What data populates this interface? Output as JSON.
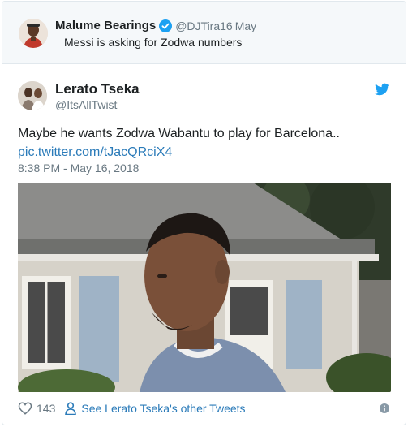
{
  "parent_tweet": {
    "name": "Malume Bearings",
    "handle": "@DJTira16",
    "date": "May",
    "text": "Messi is asking for Zodwa numbers",
    "verified": true
  },
  "tweet": {
    "name": "Lerato Tseka",
    "handle": "@ItsAllTwist",
    "text": "Maybe he wants Zodwa Wabantu to play for Barcelona..",
    "link": "pic.twitter.com/tJacQRciX4",
    "timestamp": "8:38 PM - May 16, 2018",
    "likes": "143",
    "see_more": "See Lerato Tseka's other Tweets"
  },
  "icons": {
    "verified": "verified-badge-icon",
    "bird": "twitter-bird-icon",
    "heart": "heart-icon",
    "person": "person-icon",
    "info": "info-icon"
  },
  "colors": {
    "link": "#2b7bb9",
    "muted": "#697882",
    "twitter_blue": "#1da1f2",
    "parent_bg": "#f5f8fa"
  }
}
